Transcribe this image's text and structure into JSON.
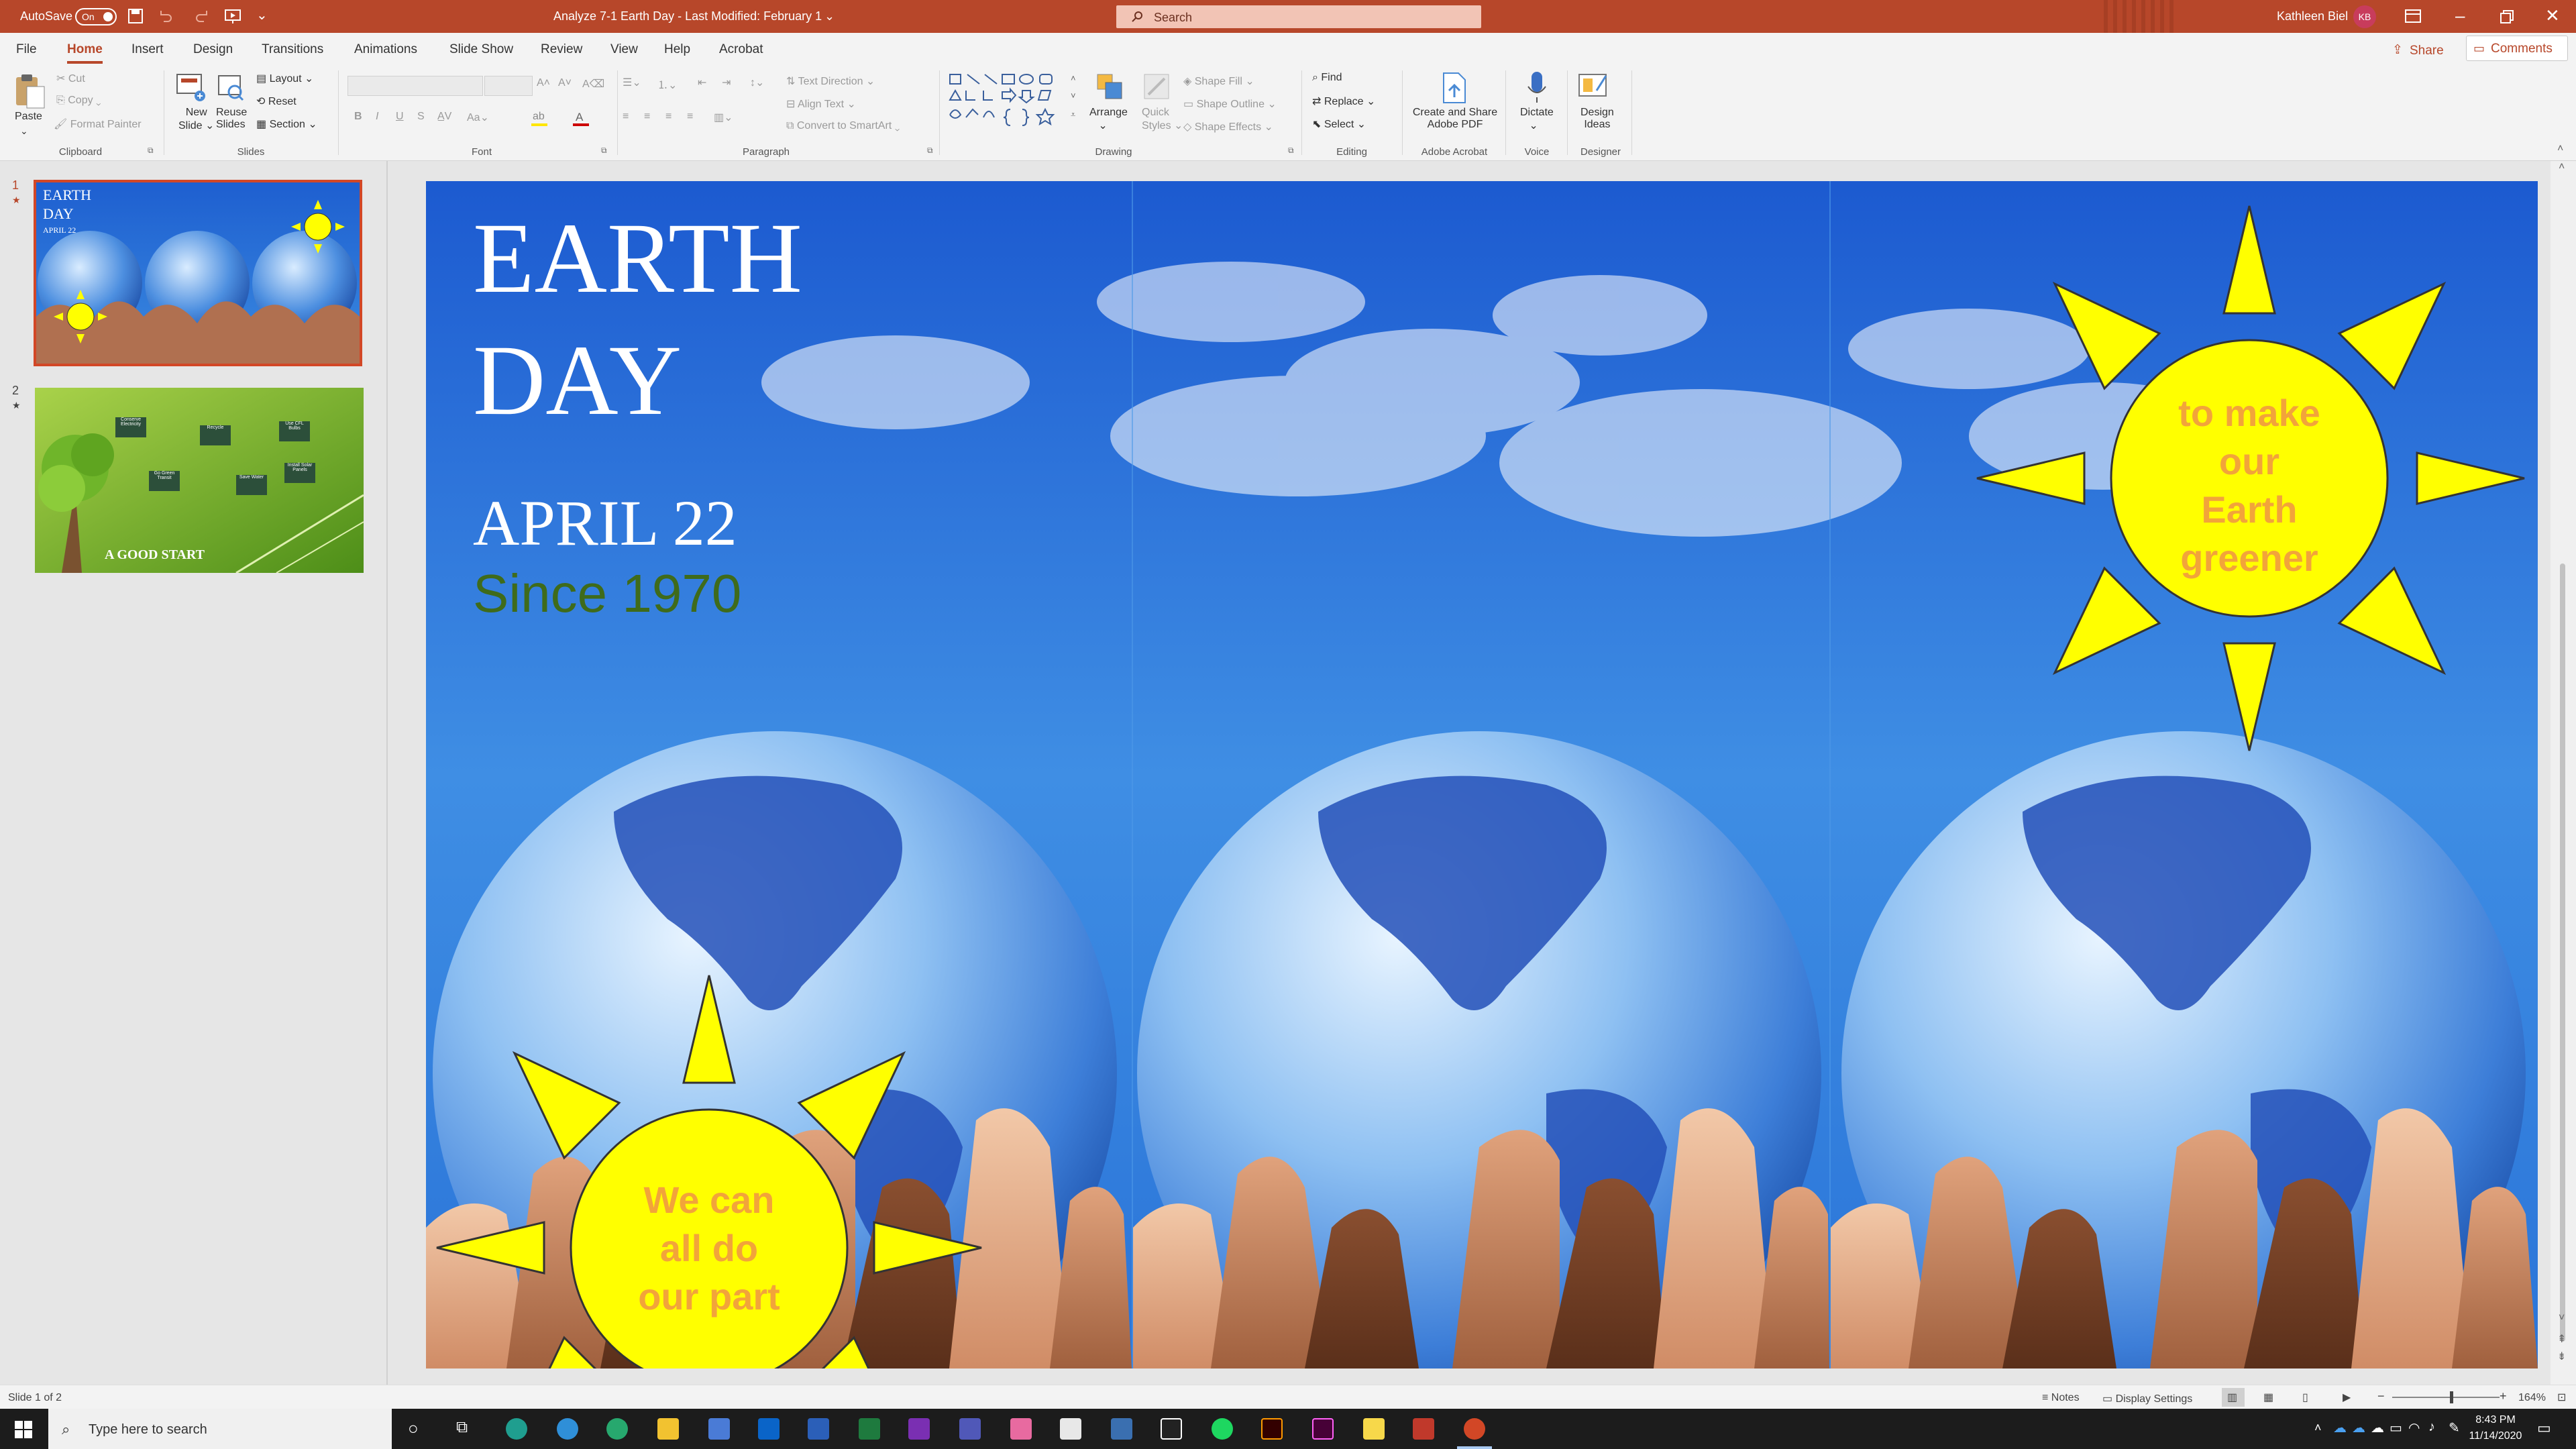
{
  "titlebar": {
    "autosave_label": "AutoSave",
    "autosave_state": "On",
    "doc_title": "Analyze 7-1 Earth Day  -  Last Modified: February 1",
    "search_placeholder": "Search",
    "user_name": "Kathleen Biel",
    "user_initials": "KB"
  },
  "tabs": [
    "File",
    "Home",
    "Insert",
    "Design",
    "Transitions",
    "Animations",
    "Slide Show",
    "Review",
    "View",
    "Help",
    "Acrobat"
  ],
  "active_tab": "Home",
  "share_label": "Share",
  "comments_label": "Comments",
  "ribbon": {
    "clipboard": {
      "paste": "Paste",
      "cut": "Cut",
      "copy": "Copy",
      "format_painter": "Format Painter",
      "group": "Clipboard"
    },
    "slides": {
      "new_slide_1": "New",
      "new_slide_2": "Slide",
      "reuse_1": "Reuse",
      "reuse_2": "Slides",
      "layout": "Layout",
      "reset": "Reset",
      "section": "Section",
      "group": "Slides"
    },
    "font": {
      "group": "Font",
      "bold": "B",
      "italic": "I",
      "underline": "U",
      "strike": "S"
    },
    "paragraph": {
      "text_direction": "Text Direction",
      "align_text": "Align Text",
      "convert": "Convert to SmartArt",
      "group": "Paragraph"
    },
    "drawing": {
      "arrange": "Arrange",
      "quick_1": "Quick",
      "quick_2": "Styles",
      "shape_fill": "Shape Fill",
      "shape_outline": "Shape Outline",
      "shape_effects": "Shape Effects",
      "group": "Drawing"
    },
    "editing": {
      "find": "Find",
      "replace": "Replace",
      "select": "Select",
      "group": "Editing"
    },
    "acrobat": {
      "line1": "Create and Share",
      "line2": "Adobe PDF",
      "group": "Adobe Acrobat"
    },
    "voice": {
      "dictate": "Dictate",
      "group": "Voice"
    },
    "designer": {
      "line1": "Design",
      "line2": "Ideas",
      "group": "Designer"
    }
  },
  "thumbnails": [
    {
      "number": "1",
      "title_line1": "EARTH",
      "title_line2": "DAY",
      "date": "APRIL 22"
    },
    {
      "number": "2",
      "caption": "A GOOD START",
      "boxes": [
        "Conserve Electricity",
        "Recycle",
        "Use CFL Bulbs",
        "Go Green Transit",
        "Save Water",
        "Install Solar Panels"
      ]
    }
  ],
  "slide": {
    "title_line1": "EARTH",
    "title_line2": "DAY",
    "date": "APRIL 22",
    "since": "Since 1970",
    "sun_left_text": [
      "We can",
      "all do",
      "our part"
    ],
    "sun_right_text": [
      "to make",
      "our",
      "Earth",
      "greener"
    ]
  },
  "statusbar": {
    "slide_info": "Slide 1 of 2",
    "notes": "Notes",
    "display_settings": "Display Settings",
    "zoom": "164%"
  },
  "taskbar": {
    "search_placeholder": "Type here to search",
    "time": "8:43 PM",
    "date": "11/14/2020"
  },
  "colors": {
    "accent": "#b7472a",
    "sun": "#ffff00",
    "sun_text": "#f2a43a",
    "since_text": "#3f6b1b"
  }
}
